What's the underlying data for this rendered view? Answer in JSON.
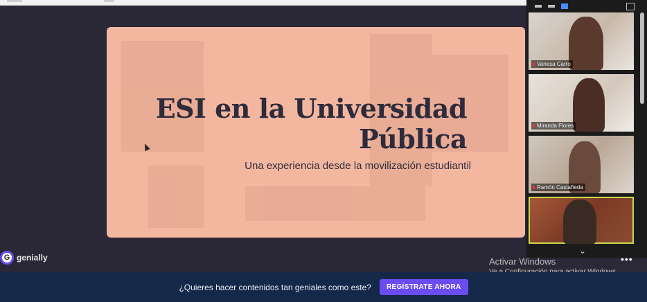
{
  "slide": {
    "title_line1": "ESI en la Universidad",
    "title_line2": "Pública",
    "subtitle": "Una experiencia desde la movilización estudiantil"
  },
  "brand": {
    "name": "genially"
  },
  "participants": [
    {
      "name": "Vanesa Carro"
    },
    {
      "name": "Miranda Flores"
    },
    {
      "name": "Ramón Castañeda"
    },
    {
      "name": ""
    }
  ],
  "windows_watermark": {
    "title": "Activar Windows",
    "subtitle": "Ve a Configuración para activar Windows."
  },
  "banner": {
    "question": "¿Quieres hacer contenidos tan geniales como este?",
    "cta": "REGÍSTRATE AHORA"
  },
  "icons": {
    "more": "more-icon",
    "chevron": "chevron-down-icon"
  }
}
